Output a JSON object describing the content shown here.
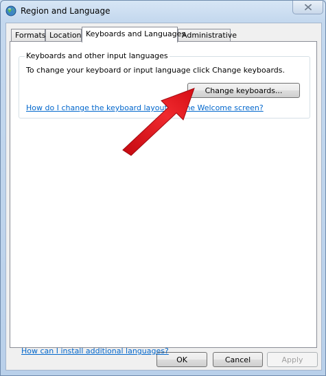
{
  "window": {
    "title": "Region and Language",
    "close_symbol": "✕"
  },
  "tabs": [
    {
      "label": "Formats"
    },
    {
      "label": "Location"
    },
    {
      "label": "Keyboards and Languages"
    },
    {
      "label": "Administrative"
    }
  ],
  "group": {
    "title": "Keyboards and other input languages",
    "description": "To change your keyboard or input language click Change keyboards.",
    "change_button": "Change keyboards...",
    "link": "How do I change the keyboard layout for the Welcome screen?"
  },
  "install_link": "How can I install additional languages?",
  "footer": {
    "ok": "OK",
    "cancel": "Cancel",
    "apply": "Apply"
  },
  "colors": {
    "link": "#0066cc",
    "annotation_arrow": "#e8141c"
  },
  "icons": {
    "title": "globe-icon",
    "close": "close-icon",
    "annotation": "red-arrow-icon"
  }
}
